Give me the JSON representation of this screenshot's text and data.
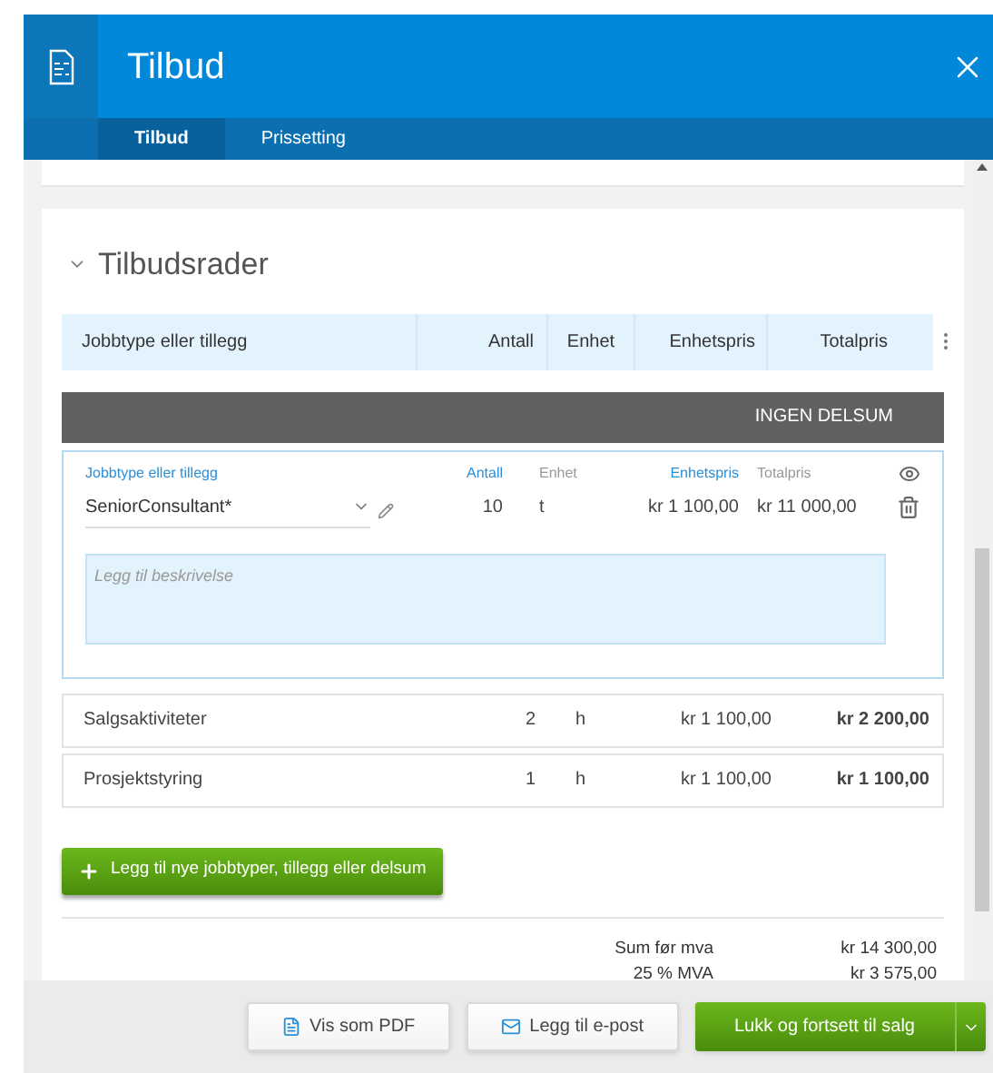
{
  "window": {
    "title": "Tilbud"
  },
  "tabs": [
    {
      "label": "Tilbud",
      "selected": true
    },
    {
      "label": "Prissetting",
      "selected": false
    }
  ],
  "section": {
    "title": "Tilbudsrader",
    "expanded": true
  },
  "table": {
    "columns": [
      "Jobbtype eller tillegg",
      "Antall",
      "Enhet",
      "Enhetspris",
      "Totalpris"
    ],
    "subtotal_bar": "INGEN DELSUM",
    "edit_row": {
      "fields": [
        {
          "label": "Jobbtype eller tillegg",
          "value": "SeniorConsultant*",
          "editable": true
        },
        {
          "label": "Antall",
          "value": "10",
          "editable": true
        },
        {
          "label": "Enhet",
          "value": "t",
          "editable": false
        },
        {
          "label": "Enhetspris",
          "value": "kr 1 100,00",
          "editable": true
        },
        {
          "label": "Totalpris",
          "value": "kr 11 000,00",
          "editable": false
        }
      ],
      "description": {
        "placeholder": "Legg til beskrivelse"
      }
    },
    "rows": [
      {
        "name": "Salgsaktiviteter",
        "quantity": "2",
        "unit": "h",
        "unit_price": "kr 1 100,00",
        "total": "kr 2 200,00"
      },
      {
        "name": "Prosjektstyring",
        "quantity": "1",
        "unit": "h",
        "unit_price": "kr 1 100,00",
        "total": "kr 1 100,00"
      }
    ]
  },
  "add_button": {
    "label": "Legg til nye jobbtyper, tillegg eller delsum"
  },
  "totals": [
    {
      "label": "Sum før mva",
      "value": "kr 14 300,00"
    },
    {
      "label": "25 % MVA",
      "value": "kr 3 575,00"
    }
  ],
  "footer_buttons": [
    {
      "label": "Vis som PDF",
      "kind": "pdf"
    },
    {
      "label": "Legg til e-post",
      "kind": "email"
    },
    {
      "label": "Lukk og fortsett til salg",
      "kind": "primary"
    }
  ]
}
